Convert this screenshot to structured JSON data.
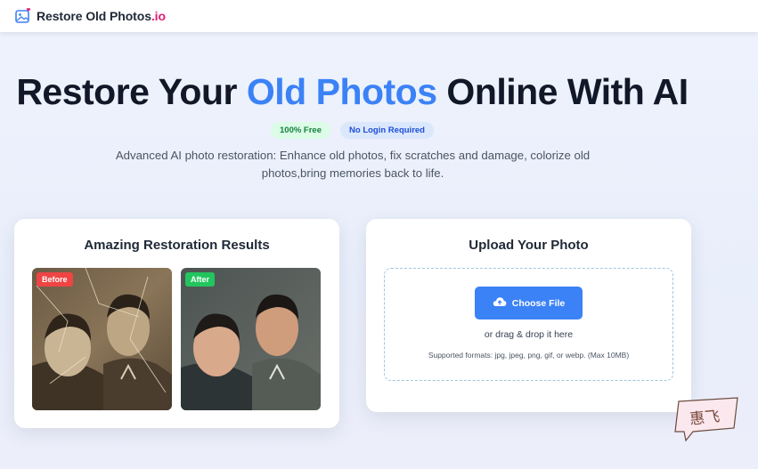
{
  "header": {
    "logo_icon": "photo-heart-icon",
    "brand_main": "Restore Old Photos",
    "brand_suffix": ".io"
  },
  "hero": {
    "title_part1": "Restore Your ",
    "title_highlight": "Old Photos",
    "title_part2": " Online With AI",
    "badges": [
      "100% Free",
      "No Login Required"
    ],
    "subtitle": "Advanced AI photo restoration: Enhance old photos, fix scratches and damage, colorize old photos,bring memories back to life."
  },
  "results": {
    "title": "Amazing Restoration Results",
    "before_label": "Before",
    "after_label": "After"
  },
  "upload": {
    "title": "Upload Your Photo",
    "button_label": "Choose File",
    "button_icon": "cloud-upload-icon",
    "drag_text": "or drag & drop it here",
    "formats_text": "Supported formats: jpg, jpeg, png, gif, or webp. (Max 10MB)"
  },
  "watermark": {
    "text": "惠飞"
  },
  "colors": {
    "accent_blue": "#3b82f6",
    "brand_pink": "#e11d74",
    "badge_green_bg": "#dcfce7",
    "badge_blue_bg": "#dbe7fb",
    "before_tag": "#ef4444",
    "after_tag": "#22c55e"
  }
}
